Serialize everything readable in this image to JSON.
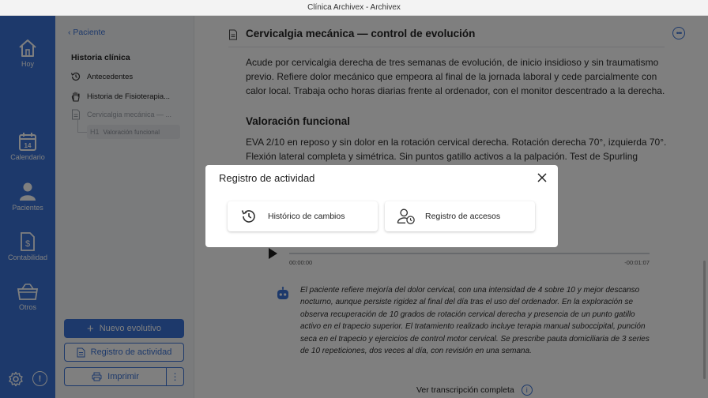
{
  "window": {
    "title": "Clínica Archivex - Archivex"
  },
  "nav": {
    "items": [
      {
        "label": "Hoy",
        "icon": "home-icon"
      },
      {
        "label": "Calendario",
        "icon": "calendar-icon",
        "badge": "14"
      },
      {
        "label": "Pacientes",
        "icon": "person-icon"
      },
      {
        "label": "Contabilidad",
        "icon": "invoice-icon"
      },
      {
        "label": "Otros",
        "icon": "box-icon"
      }
    ],
    "info_glyph": "!"
  },
  "sidebar": {
    "back_label": "Paciente",
    "heading": "Historia clínica",
    "items": [
      {
        "label": "Antecedentes",
        "icon": "history-icon"
      },
      {
        "label": "Historia de Fisioterapia...",
        "icon": "hand-icon"
      },
      {
        "label": "Cervicalgia mecánica — ...",
        "icon": "document-icon"
      }
    ],
    "sub_item": {
      "tag": "H1",
      "label": "Valoración funcional"
    },
    "buttons": {
      "new": "Nuevo evolutivo",
      "activity": "Registro de actividad",
      "print": "Imprimir",
      "more": "⋮"
    }
  },
  "document": {
    "title": "Cervicalgia mecánica — control de evolución",
    "intro": "Acude por cervicalgia derecha de tres semanas de evolución, de inicio insidioso y sin traumatismo previo. Refiere dolor mecánico que empeora al final de la jornada laboral y cede parcialmente con calor local. Trabaja ocho horas diarias frente al ordenador, con el monitor descentrado a la derecha.",
    "section_title": "Valoración funcional",
    "assessment": "EVA 2/10 en reposo y sin dolor en la rotación cervical derecha. Rotación derecha 70°, izquierda 70°. Flexión lateral completa y simétrica. Sin puntos gatillo activos a la palpación. Test de Spurling",
    "audio": {
      "start": "00:00:00",
      "end": "-00:01:07"
    },
    "transcript": "El paciente refiere mejoría del dolor cervical, con una intensidad de 4 sobre 10 y mejor descanso nocturno, aunque persiste rigidez al final del día tras el uso del ordenador. En la exploración se observa recuperación de 10 grados de rotación cervical derecha y presencia de un punto gatillo activo en el trapecio superior. El tratamiento realizado incluye terapia manual suboccipital, punción seca en el trapecio y ejercicios de control motor cervical. Se prescribe pauta domiciliaria de 3 series de 10 repeticiones, dos veces al día, con revisión en una semana.",
    "see_full": "Ver transcripción completa",
    "info_glyph": "i"
  },
  "modal": {
    "title": "Registro de actividad",
    "options": [
      {
        "label": "Histórico de cambios",
        "icon": "history-icon"
      },
      {
        "label": "Registro de accesos",
        "icon": "user-clock-icon"
      }
    ]
  },
  "colors": {
    "accent": "#3a73d6",
    "rail": "#3a73d6",
    "overlay": "rgba(0,0,0,0.5)"
  }
}
